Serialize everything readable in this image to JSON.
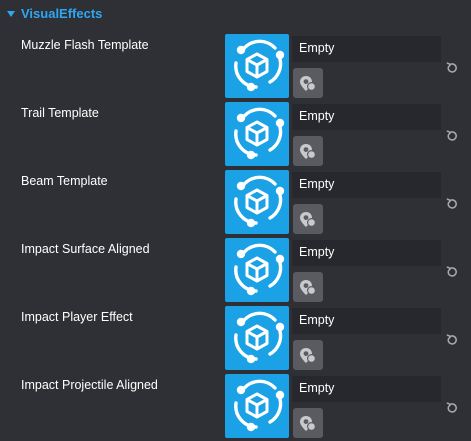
{
  "section": {
    "title": "VisualEffects",
    "expanded": true,
    "caret_icon": "caret-down-icon"
  },
  "colors": {
    "accent": "#2ea7f2",
    "thumbnail": "#1ba1e6",
    "background": "#2f3035",
    "field": "#27282d",
    "picker": "#5a5b61"
  },
  "properties": [
    {
      "label": "Muzzle Flash Template",
      "value": "Empty",
      "thumb_icon": "template-asset-icon",
      "picker_icon": "asset-picker-icon",
      "reset_icon": "reset-icon"
    },
    {
      "label": "Trail Template",
      "value": "Empty",
      "thumb_icon": "template-asset-icon",
      "picker_icon": "asset-picker-icon",
      "reset_icon": "reset-icon"
    },
    {
      "label": "Beam Template",
      "value": "Empty",
      "thumb_icon": "template-asset-icon",
      "picker_icon": "asset-picker-icon",
      "reset_icon": "reset-icon"
    },
    {
      "label": "Impact Surface Aligned",
      "value": "Empty",
      "thumb_icon": "template-asset-icon",
      "picker_icon": "asset-picker-icon",
      "reset_icon": "reset-icon"
    },
    {
      "label": "Impact Player Effect",
      "value": "Empty",
      "thumb_icon": "template-asset-icon",
      "picker_icon": "asset-picker-icon",
      "reset_icon": "reset-icon"
    },
    {
      "label": "Impact Projectile Aligned",
      "value": "Empty",
      "thumb_icon": "template-asset-icon",
      "picker_icon": "asset-picker-icon",
      "reset_icon": "reset-icon"
    }
  ]
}
